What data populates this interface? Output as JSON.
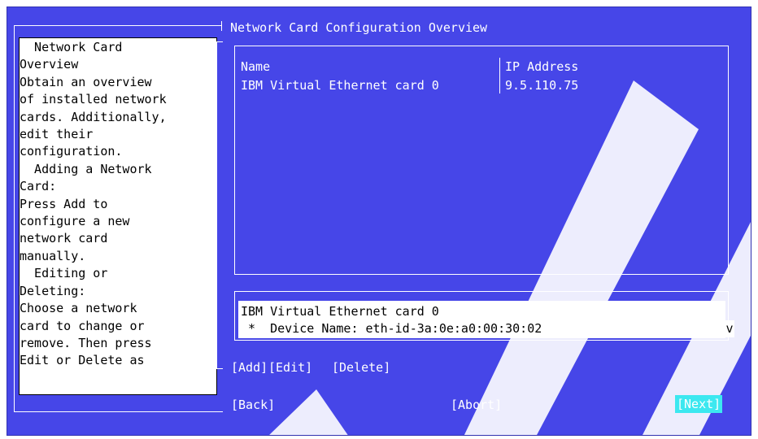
{
  "help": {
    "lines": [
      "  Network Card",
      "Overview",
      "Obtain an overview",
      "of installed network",
      "cards. Additionally,",
      "edit their",
      "configuration.",
      "  Adding a Network",
      "Card:",
      "Press Add to",
      "configure a new",
      "network card",
      "manually.",
      "  Editing or",
      "Deleting:",
      "Choose a network",
      "card to change or",
      "remove. Then press",
      "Edit or Delete as"
    ]
  },
  "main": {
    "title": "Network Card Configuration Overview",
    "table": {
      "headers": [
        "Name",
        "IP Address"
      ],
      "rows": [
        {
          "name": "IBM Virtual Ethernet card 0",
          "ip": "9.5.110.75"
        }
      ]
    },
    "detail": {
      "line1": "IBM Virtual Ethernet card 0",
      "line2": " *  Device Name: eth-id-3a:0e:a0:00:30:02",
      "scroll_arrow": "v"
    }
  },
  "buttons": {
    "add": "[Add]",
    "edit": "[Edit]",
    "delete": "[Delete]",
    "back": "[Back]",
    "abort": "[Abort]",
    "next": "[Next]"
  },
  "colors": {
    "background": "#4646e8",
    "panel": "#ffffff",
    "focus": "#3ce8f0"
  }
}
